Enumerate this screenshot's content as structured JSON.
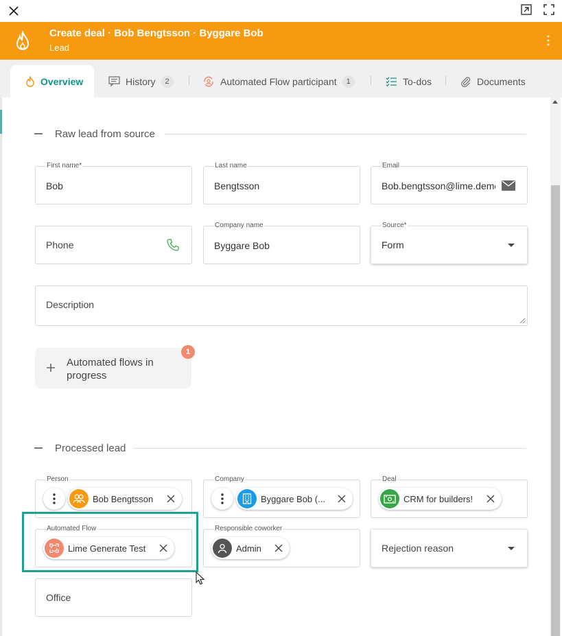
{
  "window": {
    "close_icon": "close-icon",
    "open_external_icon": "open-external-icon",
    "fullscreen_icon": "fullscreen-icon"
  },
  "header": {
    "title": "Create deal · Bob Bengtsson · Byggare Bob",
    "subtitle": "Lead",
    "color": "#f89a10"
  },
  "tabs": [
    {
      "label": "Overview",
      "active": true
    },
    {
      "label": "History",
      "badge": "2"
    },
    {
      "label": "Automated Flow participant",
      "badge": "1"
    },
    {
      "label": "To-dos"
    },
    {
      "label": "Documents"
    }
  ],
  "raw_lead": {
    "section_title": "Raw lead from source",
    "first_name": {
      "label": "First name*",
      "value": "Bob"
    },
    "last_name": {
      "label": "Last name",
      "value": "Bengtsson"
    },
    "email": {
      "label": "Email",
      "value": "Bob.bengtsson@lime.demo"
    },
    "phone": {
      "placeholder": "Phone"
    },
    "company_name": {
      "label": "Company name",
      "value": "Byggare Bob"
    },
    "source": {
      "label": "Source*",
      "value": "Form"
    },
    "description": {
      "placeholder": "Description"
    },
    "automated_flows": {
      "label": "Automated flows in progress",
      "badge": "1"
    }
  },
  "processed_lead": {
    "section_title": "Processed lead",
    "person": {
      "label": "Person",
      "value": "Bob Bengtsson"
    },
    "company": {
      "label": "Company",
      "value": "Byggare Bob (..."
    },
    "deal": {
      "label": "Deal",
      "value": "CRM for builders!"
    },
    "automated_flow": {
      "label": "Automated Flow",
      "value": "Lime Generate Test"
    },
    "responsible": {
      "label": "Responsible coworker",
      "value": "Admin"
    },
    "rejection": {
      "placeholder": "Rejection reason"
    },
    "office": {
      "placeholder": "Office"
    }
  },
  "colors": {
    "accent": "#0d9488",
    "person_avatar": "#f89a10",
    "company_avatar": "#1a9be6",
    "deal_avatar": "#3aa548",
    "flow_avatar": "#f2896f",
    "admin_avatar": "#555555",
    "highlight": "#1fa18f"
  }
}
